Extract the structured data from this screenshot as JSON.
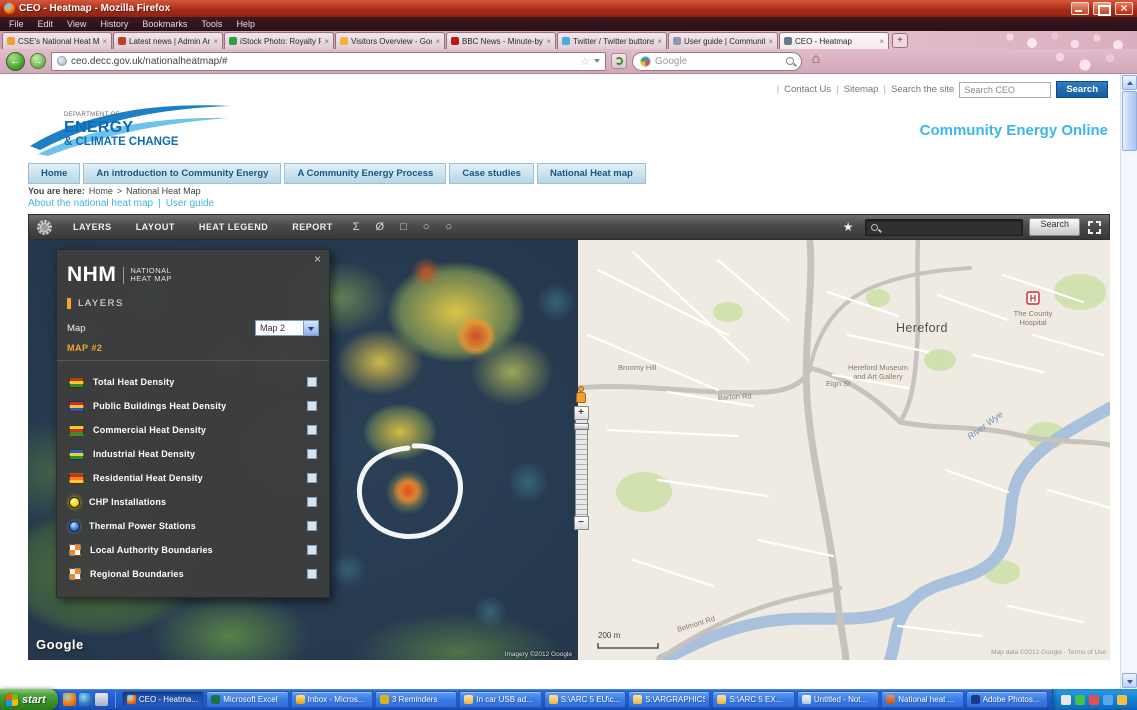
{
  "colors": {
    "titlebar_red": "#a82a14",
    "persona_pink": "#d3adbc",
    "site_brand_blue": "#3cb6e8",
    "site_nav_blue": "#b6d6e8",
    "site_button_blue": "#155a9e",
    "toolbar_grey": "#4a4a4a",
    "panel_grey": "#3e3e3e",
    "accent_orange": "#f0a830",
    "heat_scale": [
      "#2b4158",
      "#488ea2",
      "#6cb25a",
      "#f0cc30",
      "#e08030",
      "#d03020"
    ],
    "taskbar_blue": "#2160cf",
    "start_green": "#378c27"
  },
  "window": {
    "title": "CEO - Heatmap - Mozilla Firefox"
  },
  "menubar": {
    "items": [
      "File",
      "Edit",
      "View",
      "History",
      "Bookmarks",
      "Tools",
      "Help"
    ]
  },
  "tabs": [
    {
      "label": "CSE's National Heat Map laun..."
    },
    {
      "label": "Latest news | Admin Area | Ce..."
    },
    {
      "label": "iStock Photo: Royalty Free Sto..."
    },
    {
      "label": "Visitors Overview - Google Anal..."
    },
    {
      "label": "BBC News - Minute-by-minute ..."
    },
    {
      "label": "Twitter / Twitter buttons"
    },
    {
      "label": "User guide | Community Energ..."
    },
    {
      "label": "CEO - Heatmap"
    }
  ],
  "addressbar": {
    "url": "ceo.decc.gov.uk/nationalheatmap/#",
    "search_placeholder": "Google"
  },
  "page": {
    "utility": {
      "links": [
        "Contact Us",
        "Sitemap",
        "Search the site"
      ],
      "search_value": "Search CEO",
      "search_button": "Search"
    },
    "logo": {
      "dept": "DEPARTMENT OF",
      "line1": "ENERGY",
      "line2": "& CLIMATE",
      "line3": "CHANGE"
    },
    "brand": "Community Energy Online",
    "nav": [
      {
        "label": "Home"
      },
      {
        "label": "An introduction to Community Energy"
      },
      {
        "label": "A Community Energy Process"
      },
      {
        "label": "Case studies"
      },
      {
        "label": "National Heat map"
      }
    ],
    "breadcrumb": {
      "prefix": "You are here:",
      "home": "Home",
      "separator": ">",
      "current": "National Heat Map"
    },
    "sublinks": {
      "about": "About the national heat map",
      "divider": "|",
      "guide": "User guide"
    }
  },
  "heatmap_app": {
    "toolbar": {
      "buttons": [
        "LAYERS",
        "LAYOUT",
        "HEAT LEGEND",
        "REPORT"
      ],
      "tools": [
        "Σ",
        "Ø",
        "□",
        "○",
        "○"
      ],
      "search_button": "Search"
    },
    "panel": {
      "logo_abbr": "NHM",
      "logo_line1": "NATIONAL",
      "logo_line2": "HEAT MAP",
      "close": "×",
      "section": "LAYERS",
      "map_label": "Map",
      "map_value": "Map 2",
      "map_caption": "MAP #2",
      "layers": [
        {
          "label": "Total Heat Density"
        },
        {
          "label": "Public Buildings Heat Density"
        },
        {
          "label": "Commercial Heat Density"
        },
        {
          "label": "Industrial Heat Density"
        },
        {
          "label": "Residential Heat Density"
        },
        {
          "label": "CHP Installations"
        },
        {
          "label": "Thermal Power Stations"
        },
        {
          "label": "Local Authority Boundaries"
        },
        {
          "label": "Regional Boundaries"
        }
      ]
    },
    "map": {
      "city": "Hereford",
      "hospital_marker": "H",
      "hospital_line1": "The County",
      "hospital_line2": "Hospital",
      "museum_line1": "Hereford Museum",
      "museum_line2": "and Art Gallery",
      "river": "River Wye",
      "hill": "Broomy Hill",
      "road_barton": "Barton Rd",
      "road_belmont": "Belmont Rd",
      "road_eign": "Eign St",
      "scale": "200 m",
      "google": "Google",
      "attribution_right": "Map data ©2012 Google - Terms of Use",
      "attribution_left": "Imagery ©2012 Google"
    },
    "zoom": {
      "plus": "+",
      "minus": "−"
    }
  },
  "taskbar": {
    "start": "start",
    "tasks": [
      {
        "label": "CEO - Heatma..."
      },
      {
        "label": "Microsoft Excel"
      },
      {
        "label": "Inbox - Micros..."
      },
      {
        "label": "3 Reminders"
      },
      {
        "label": "In car USB ad..."
      },
      {
        "label": "S:\\ARC 5 EU\\c..."
      },
      {
        "label": "S:\\ARGRAPHICS"
      },
      {
        "label": "S:\\ARC 5 EX..."
      },
      {
        "label": "Untitled - Not..."
      },
      {
        "label": "National heat ..."
      },
      {
        "label": "Adobe Photos..."
      }
    ]
  }
}
